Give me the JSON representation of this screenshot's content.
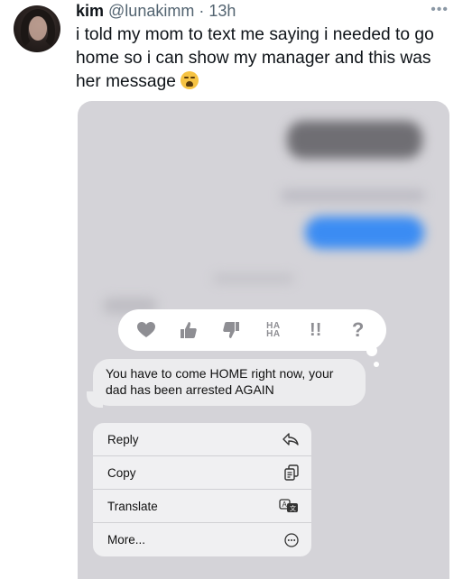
{
  "tweet": {
    "author_name": "kim",
    "handle": "@lunakimm",
    "separator": "·",
    "time": "13h",
    "more_label": "•••",
    "text": "i told my mom to text me saying i needed to go home so i can show my manager and this was her message",
    "emoji": "crying-face-emoji"
  },
  "screenshot": {
    "reactions": [
      {
        "name": "heart",
        "icon": "heart-icon"
      },
      {
        "name": "thumbs-up",
        "icon": "thumbs-up-icon"
      },
      {
        "name": "thumbs-down",
        "icon": "thumbs-down-icon"
      },
      {
        "name": "haha",
        "label_top": "HA",
        "label_bottom": "HA"
      },
      {
        "name": "emphasize",
        "label": "!!"
      },
      {
        "name": "question",
        "label": "?"
      }
    ],
    "message": "You have to come HOME right now, your dad has been arrested AGAIN",
    "menu": [
      {
        "label": "Reply",
        "icon": "reply-icon"
      },
      {
        "label": "Copy",
        "icon": "copy-icon"
      },
      {
        "label": "Translate",
        "icon": "translate-icon"
      },
      {
        "label": "More...",
        "icon": "more-icon"
      }
    ]
  },
  "colors": {
    "blurred_bubble_blue": "#3b8cf3",
    "icon_gray": "#8e8e93",
    "background_gray": "#d4d3d8"
  }
}
